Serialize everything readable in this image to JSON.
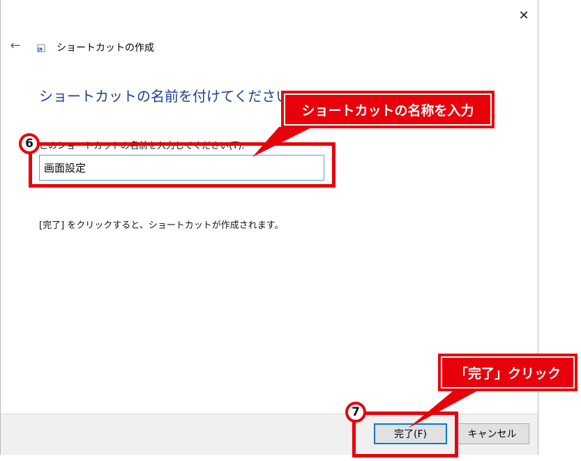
{
  "window": {
    "title": "ショートカットの作成",
    "close_glyph": "✕",
    "back_glyph": "←"
  },
  "main": {
    "heading": "ショートカットの名前を付けてください。",
    "field_label": "このショートカットの名前を入力してください(T):",
    "name_value": "画面設定",
    "hint": "[完了] をクリックすると、ショートカットが作成されます。"
  },
  "footer": {
    "finish_label": "完了(F)",
    "cancel_label": "キャンセル"
  },
  "annotations": {
    "step6_number": "6",
    "step6_callout": "ショートカットの名称を入力",
    "step7_number": "7",
    "step7_callout": "「完了」クリック",
    "color": "#e8000b"
  }
}
